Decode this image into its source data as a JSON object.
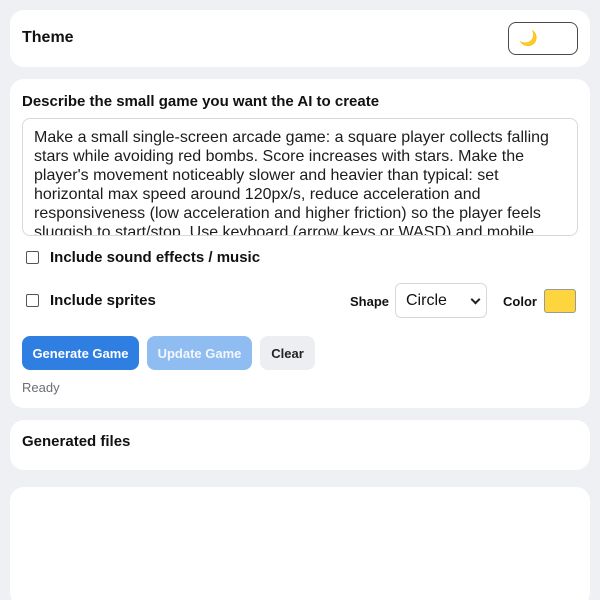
{
  "theme": {
    "title": "Theme",
    "toggle_icon": "moon-icon",
    "toggle_glyph": "🌙"
  },
  "prompt": {
    "label": "Describe the small game you want the AI to create",
    "text": "Make a small single-screen arcade game: a square player collects falling stars while avoiding red bombs. Score increases with stars. Make the player's movement noticeably slower and heavier than typical: set horizontal max speed around 120px/s, reduce acceleration and responsiveness (low acceleration and higher friction) so the player feels sluggish to start/stop. Use keyboard (arrow keys or WASD) and mobile touch controls."
  },
  "options": {
    "sound_label": "Include sound effects / music",
    "sound_checked": false,
    "sprites_label": "Include sprites",
    "sprites_checked": false,
    "shape_label": "Shape",
    "shape_value": "Circle",
    "color_label": "Color",
    "color_value": "#fdd53f"
  },
  "buttons": {
    "generate": "Generate Game",
    "update": "Update Game",
    "clear": "Clear"
  },
  "status": "Ready",
  "files": {
    "title": "Generated files"
  },
  "colors": {
    "accent": "#2f7fe3",
    "accent_disabled": "#8fbdf2",
    "background": "#eef0f3"
  }
}
